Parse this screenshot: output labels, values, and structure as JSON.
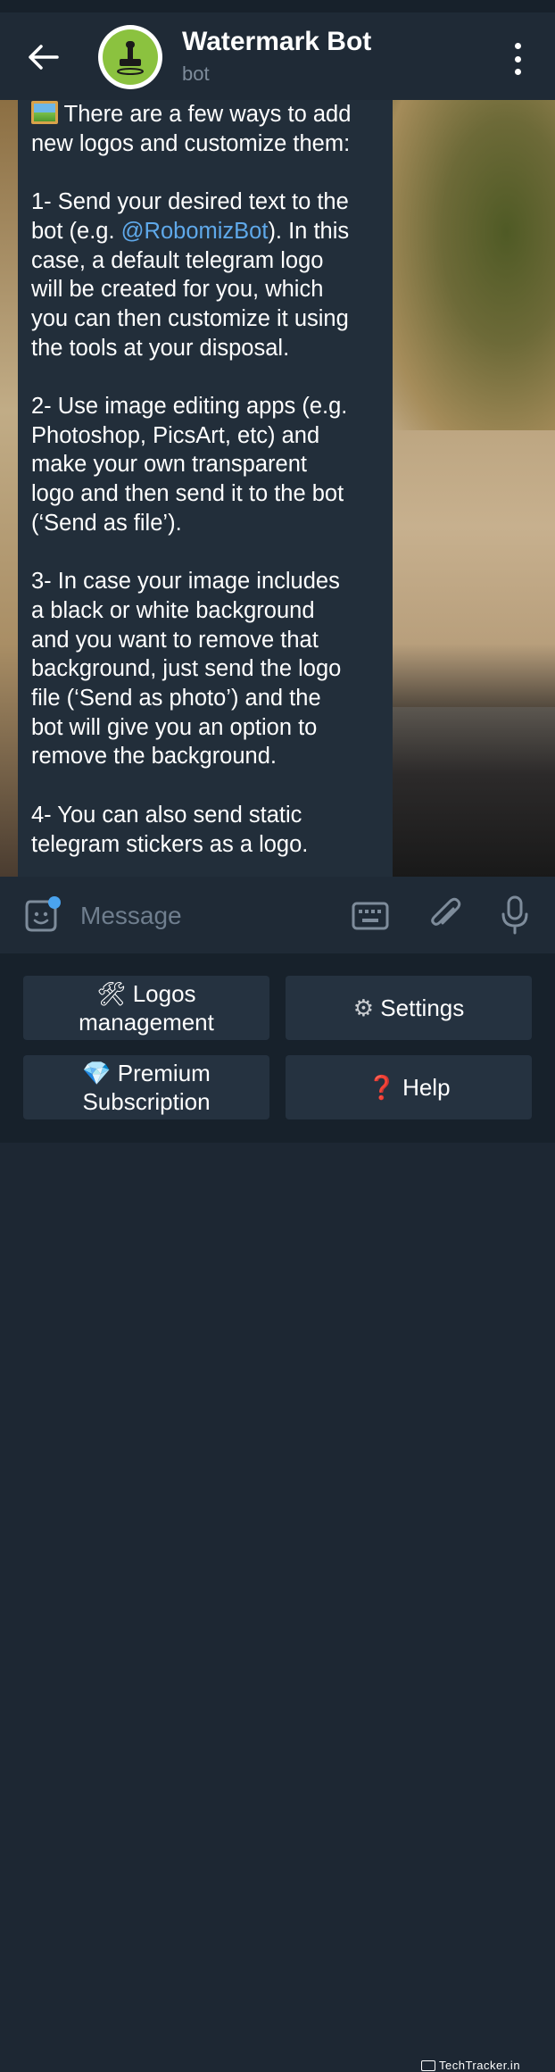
{
  "header": {
    "title": "Watermark Bot",
    "subtitle": "bot"
  },
  "message": {
    "lines": [
      " There are a few ways to add",
      "new logos and customize them:",
      "",
      "1- Send your desired text to the",
      "bot (e.g. ",
      "). In this",
      "case, a default telegram logo",
      "will be created for you, which",
      "you can then customize it using",
      "the tools at your disposal.",
      "",
      "2- Use image editing apps (e.g.",
      "Photoshop, PicsArt, etc) and",
      "make your own transparent",
      "logo and then send it to the bot",
      "(‘Send as file’).",
      "",
      "3- In case your image includes",
      "a black or white background",
      "and you want to remove that",
      "background, just send the logo",
      "file (‘Send as photo’) and the",
      "bot will give you an option to",
      "remove the background.",
      "",
      "4- You can also send static",
      "telegram stickers as a logo."
    ],
    "mention": "@RobomizBot"
  },
  "input": {
    "placeholder": "Message"
  },
  "keyboard": {
    "logos_icon": "🛠",
    "logos_line1": "Logos",
    "logos_line2": "management",
    "settings_icon": "⚙",
    "settings_label": "Settings",
    "premium_icon": "💎",
    "premium_line1": "Premium",
    "premium_line2": "Subscription",
    "help_icon": "❓",
    "help_label": "Help"
  },
  "watermark": "TechTracker.in",
  "colors": {
    "accent": "#5fa9ea",
    "header_bg": "#1f2a36",
    "bubble_bg": "#222e3a",
    "button_bg": "#253240"
  }
}
